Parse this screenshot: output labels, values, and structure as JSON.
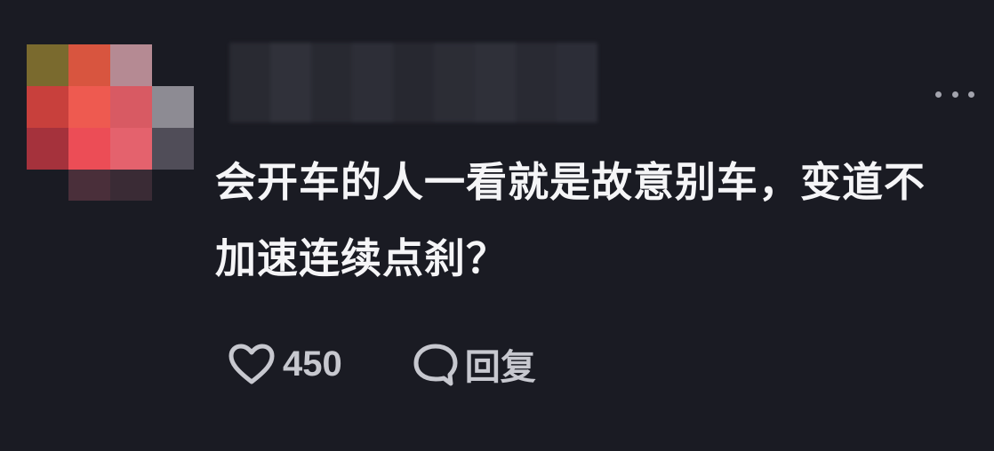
{
  "comment": {
    "text": "会开车的人一看就是故意别车，变道不加速连续点刹？",
    "like_count": "450",
    "reply_label": "回复"
  },
  "colors": {
    "background": "#1a1b23",
    "text": "#f5f5f7",
    "muted": "#c7c8cf"
  },
  "icons": {
    "more": "more-dots-icon",
    "like": "heart-icon",
    "reply": "speech-bubble-icon"
  }
}
